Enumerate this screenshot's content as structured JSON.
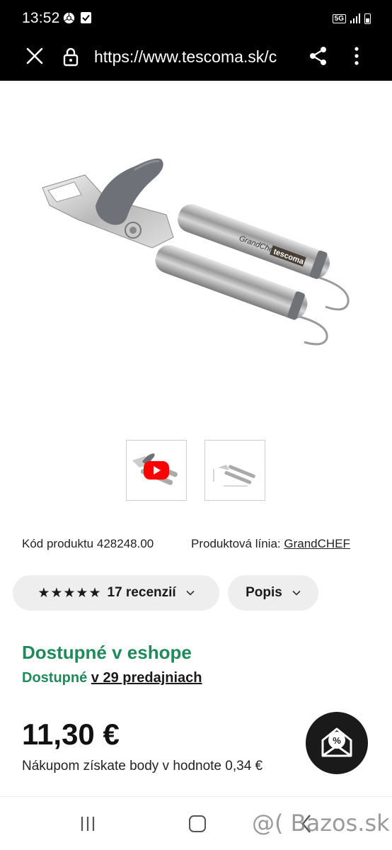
{
  "status_bar": {
    "time": "13:52",
    "network": "5G",
    "icons": [
      "chrome-icon",
      "check-notification-icon",
      "signal-icon",
      "battery-icon"
    ]
  },
  "browser": {
    "url_display": "https://www.tescoma.sk/c",
    "icons": [
      "close-icon",
      "lock-icon",
      "share-icon",
      "more-vert-icon"
    ]
  },
  "product": {
    "image_labels": {
      "brand_line": "GrandChef",
      "brand": "tescoma"
    },
    "thumbnails": [
      "video-thumbnail",
      "dimensions-thumbnail"
    ],
    "code_label": "Kód produktu",
    "code_value": "428248.00",
    "line_label": "Produktová línia:",
    "line_value": "GrandCHEF"
  },
  "chips": {
    "reviews_stars": "★★★★★",
    "reviews_label": "17 recenzií",
    "description_label": "Popis"
  },
  "availability": {
    "eshop": "Dostupné v eshope",
    "stores_prefix": "Dostupné",
    "stores_link": "v 29 predajniach",
    "color": "#1f8a5b"
  },
  "pricing": {
    "price": "11,30 €",
    "points_text": "Nákupom získate body v hodnote 0,34 €"
  },
  "watermark": "@( Bazos.sk"
}
